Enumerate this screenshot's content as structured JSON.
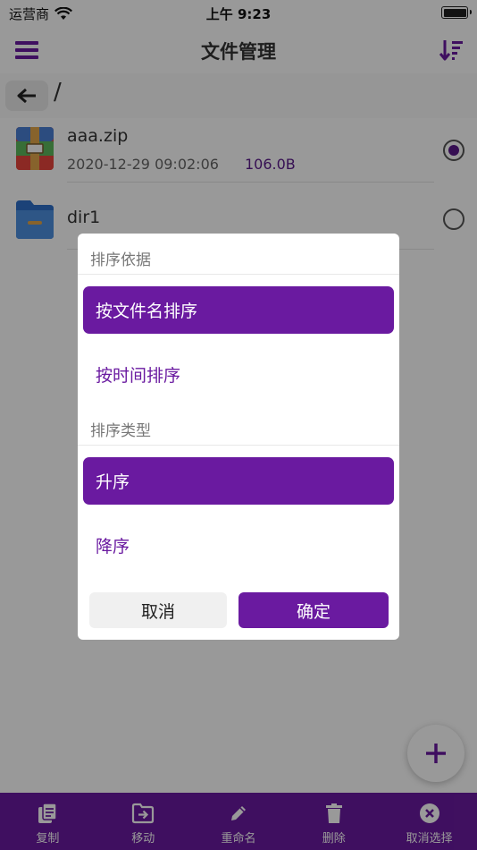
{
  "status_bar": {
    "carrier": "运营商",
    "time": "上午 9:23"
  },
  "nav": {
    "title": "文件管理",
    "menu_icon": "hamburger-menu-icon",
    "sort_icon": "sort-descending-icon"
  },
  "path_bar": {
    "back_icon": "arrow-left-icon",
    "path": "/"
  },
  "files": [
    {
      "name": "aaa.zip",
      "date": "2020-12-29 09:02:06",
      "size": "106.0B",
      "icon": "zip-archive-icon",
      "selected": true
    },
    {
      "name": "dir1",
      "date": "",
      "size": "",
      "icon": "folder-icon",
      "selected": false
    }
  ],
  "sort_dialog": {
    "basis_title": "排序依据",
    "basis_options": [
      {
        "label": "按文件名排序",
        "selected": true
      },
      {
        "label": "按时间排序",
        "selected": false
      }
    ],
    "type_title": "排序类型",
    "type_options": [
      {
        "label": "升序",
        "selected": true
      },
      {
        "label": "降序",
        "selected": false
      }
    ],
    "cancel_label": "取消",
    "ok_label": "确定"
  },
  "fab": {
    "icon": "plus-icon"
  },
  "toolbar": {
    "items": [
      {
        "label": "复制",
        "icon": "copy-icon"
      },
      {
        "label": "移动",
        "icon": "move-icon"
      },
      {
        "label": "重命名",
        "icon": "pencil-icon"
      },
      {
        "label": "删除",
        "icon": "trash-icon"
      },
      {
        "label": "取消选择",
        "icon": "close-circle-icon"
      }
    ]
  },
  "colors": {
    "accent": "#6a1aa0",
    "text": "#333333",
    "overlay": "rgba(0,0,0,0.4)"
  }
}
